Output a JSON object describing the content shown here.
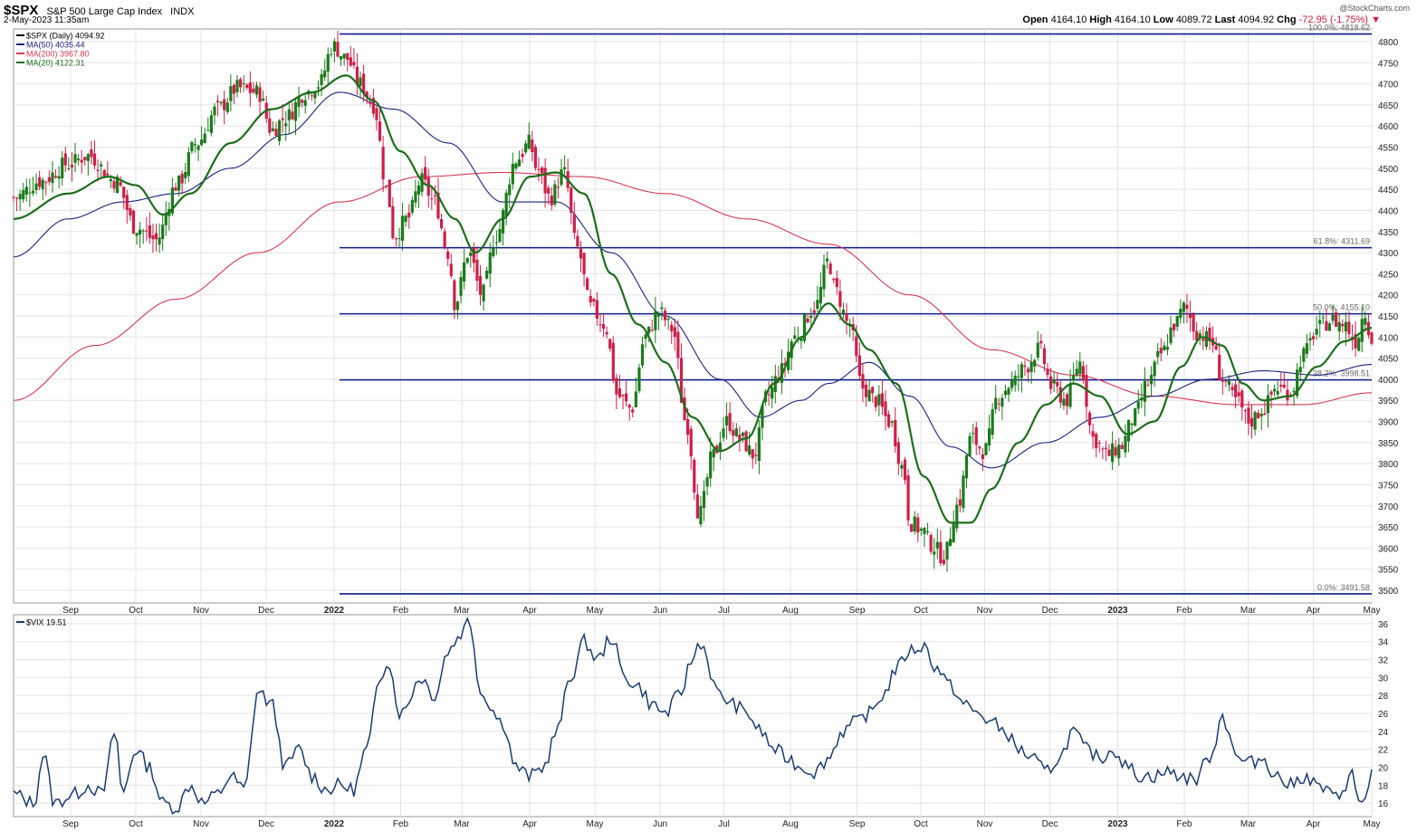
{
  "header": {
    "symbol": "$SPX",
    "description": "S&P 500 Large Cap Index",
    "exchange": "INDX",
    "datetime": "2-May-2023 11:35am",
    "brand": "@StockCharts.com",
    "open_label": "Open",
    "open": "4164.10",
    "high_label": "High",
    "high": "4164.10",
    "low_label": "Low",
    "low": "4089.72",
    "last_label": "Last",
    "last": "4094.92",
    "chg_label": "Chg",
    "chg": "-72.95 (-1.75%)"
  },
  "colors": {
    "price_up": "#1c7a1c",
    "price_down": "#cc1f4a",
    "ma50": "#1a237e",
    "ma200": "#d33a52",
    "ma20": "#1b6e1b",
    "fib": "#0d1a8c",
    "vix": "#1a3b6e",
    "grid": "#e3e3e3",
    "frame": "#9a9a9a"
  },
  "chart_data": [
    {
      "type": "candlestick",
      "title": "$SPX (Daily)",
      "legend": [
        {
          "name": "$SPX (Daily)",
          "value": "4094.92"
        },
        {
          "name": "MA(50)",
          "value": "4035.44"
        },
        {
          "name": "MA(200)",
          "value": "3967.80"
        },
        {
          "name": "MA(20)",
          "value": "4122.31"
        }
      ],
      "ylim": [
        3470,
        4830
      ],
      "yticks": [
        3500,
        3550,
        3600,
        3650,
        3700,
        3750,
        3800,
        3850,
        3900,
        3950,
        4000,
        4050,
        4100,
        4150,
        4200,
        4250,
        4300,
        4350,
        4400,
        4450,
        4500,
        4550,
        4600,
        4650,
        4700,
        4750,
        4800
      ],
      "x_labels": [
        {
          "label": "Sep",
          "t": 0.042
        },
        {
          "label": "Oct",
          "t": 0.09
        },
        {
          "label": "Nov",
          "t": 0.138
        },
        {
          "label": "Dec",
          "t": 0.186
        },
        {
          "label": "2022",
          "t": 0.236,
          "bold": true
        },
        {
          "label": "Feb",
          "t": 0.285
        },
        {
          "label": "Mar",
          "t": 0.33
        },
        {
          "label": "Apr",
          "t": 0.38
        },
        {
          "label": "May",
          "t": 0.428
        },
        {
          "label": "Jun",
          "t": 0.476
        },
        {
          "label": "Jul",
          "t": 0.523
        },
        {
          "label": "Aug",
          "t": 0.572
        },
        {
          "label": "Sep",
          "t": 0.621
        },
        {
          "label": "Oct",
          "t": 0.668
        },
        {
          "label": "Nov",
          "t": 0.715
        },
        {
          "label": "Dec",
          "t": 0.763
        },
        {
          "label": "2023",
          "t": 0.813,
          "bold": true
        },
        {
          "label": "Feb",
          "t": 0.862
        },
        {
          "label": "Mar",
          "t": 0.909
        },
        {
          "label": "Apr",
          "t": 0.957
        },
        {
          "label": "May",
          "t": 1.0
        }
      ],
      "fib_levels": [
        {
          "value": 4818,
          "label": "100.0%: 4818.62"
        },
        {
          "value": 4311.69,
          "label": "61.8%: 4311.69"
        },
        {
          "value": 4155.1,
          "label": "50.0%: 4155.10"
        },
        {
          "value": 3998.51,
          "label": "38.2%: 3998.51"
        },
        {
          "value": 3491.58,
          "label": "0.0%: 3491.58"
        }
      ],
      "close_anchors": [
        [
          0.0,
          4430
        ],
        [
          0.02,
          4470
        ],
        [
          0.04,
          4510
        ],
        [
          0.055,
          4530
        ],
        [
          0.075,
          4470
        ],
        [
          0.09,
          4360
        ],
        [
          0.105,
          4330
        ],
        [
          0.12,
          4460
        ],
        [
          0.135,
          4560
        ],
        [
          0.15,
          4640
        ],
        [
          0.165,
          4690
        ],
        [
          0.18,
          4680
        ],
        [
          0.19,
          4590
        ],
        [
          0.2,
          4620
        ],
        [
          0.215,
          4680
        ],
        [
          0.225,
          4700
        ],
        [
          0.235,
          4790
        ],
        [
          0.245,
          4760
        ],
        [
          0.255,
          4700
        ],
        [
          0.265,
          4650
        ],
        [
          0.275,
          4450
        ],
        [
          0.28,
          4340
        ],
        [
          0.29,
          4380
        ],
        [
          0.3,
          4470
        ],
        [
          0.31,
          4420
        ],
        [
          0.32,
          4300
        ],
        [
          0.325,
          4180
        ],
        [
          0.335,
          4300
        ],
        [
          0.345,
          4200
        ],
        [
          0.355,
          4340
        ],
        [
          0.37,
          4520
        ],
        [
          0.38,
          4560
        ],
        [
          0.385,
          4500
        ],
        [
          0.395,
          4430
        ],
        [
          0.405,
          4490
        ],
        [
          0.415,
          4310
        ],
        [
          0.425,
          4170
        ],
        [
          0.435,
          4130
        ],
        [
          0.445,
          3960
        ],
        [
          0.455,
          3930
        ],
        [
          0.465,
          4100
        ],
        [
          0.475,
          4160
        ],
        [
          0.485,
          4120
        ],
        [
          0.495,
          3900
        ],
        [
          0.505,
          3680
        ],
        [
          0.515,
          3820
        ],
        [
          0.525,
          3900
        ],
        [
          0.535,
          3860
        ],
        [
          0.545,
          3820
        ],
        [
          0.555,
          3960
        ],
        [
          0.565,
          4020
        ],
        [
          0.575,
          4100
        ],
        [
          0.59,
          4170
        ],
        [
          0.6,
          4280
        ],
        [
          0.605,
          4210
        ],
        [
          0.615,
          4130
        ],
        [
          0.625,
          3980
        ],
        [
          0.635,
          3950
        ],
        [
          0.645,
          3900
        ],
        [
          0.655,
          3790
        ],
        [
          0.66,
          3660
        ],
        [
          0.67,
          3640
        ],
        [
          0.675,
          3610
        ],
        [
          0.685,
          3580
        ],
        [
          0.695,
          3700
        ],
        [
          0.705,
          3860
        ],
        [
          0.715,
          3830
        ],
        [
          0.725,
          3960
        ],
        [
          0.735,
          3990
        ],
        [
          0.745,
          4030
        ],
        [
          0.755,
          4070
        ],
        [
          0.765,
          3980
        ],
        [
          0.775,
          3950
        ],
        [
          0.785,
          4040
        ],
        [
          0.795,
          3860
        ],
        [
          0.805,
          3820
        ],
        [
          0.815,
          3840
        ],
        [
          0.825,
          3910
        ],
        [
          0.835,
          3990
        ],
        [
          0.845,
          4060
        ],
        [
          0.855,
          4130
        ],
        [
          0.862,
          4170
        ],
        [
          0.872,
          4110
        ],
        [
          0.882,
          4090
        ],
        [
          0.89,
          4000
        ],
        [
          0.9,
          3950
        ],
        [
          0.91,
          3900
        ],
        [
          0.92,
          3930
        ],
        [
          0.93,
          3980
        ],
        [
          0.94,
          3970
        ],
        [
          0.95,
          4060
        ],
        [
          0.96,
          4120
        ],
        [
          0.97,
          4140
        ],
        [
          0.98,
          4130
        ],
        [
          0.988,
          4090
        ],
        [
          0.995,
          4160
        ],
        [
          1.0,
          4094
        ]
      ],
      "ma50_anchors": [
        [
          0.0,
          4290
        ],
        [
          0.04,
          4380
        ],
        [
          0.08,
          4420
        ],
        [
          0.12,
          4440
        ],
        [
          0.16,
          4500
        ],
        [
          0.2,
          4580
        ],
        [
          0.24,
          4680
        ],
        [
          0.28,
          4640
        ],
        [
          0.32,
          4560
        ],
        [
          0.36,
          4420
        ],
        [
          0.4,
          4420
        ],
        [
          0.44,
          4300
        ],
        [
          0.48,
          4150
        ],
        [
          0.52,
          4000
        ],
        [
          0.55,
          3910
        ],
        [
          0.58,
          3950
        ],
        [
          0.6,
          3990
        ],
        [
          0.63,
          4040
        ],
        [
          0.66,
          3960
        ],
        [
          0.69,
          3840
        ],
        [
          0.72,
          3790
        ],
        [
          0.76,
          3850
        ],
        [
          0.8,
          3910
        ],
        [
          0.84,
          3960
        ],
        [
          0.88,
          4000
        ],
        [
          0.92,
          4020
        ],
        [
          0.96,
          4010
        ],
        [
          1.0,
          4035
        ]
      ],
      "ma200_anchors": [
        [
          0.0,
          3950
        ],
        [
          0.06,
          4080
        ],
        [
          0.12,
          4190
        ],
        [
          0.18,
          4300
        ],
        [
          0.24,
          4420
        ],
        [
          0.3,
          4480
        ],
        [
          0.36,
          4490
        ],
        [
          0.42,
          4480
        ],
        [
          0.48,
          4440
        ],
        [
          0.54,
          4380
        ],
        [
          0.6,
          4320
        ],
        [
          0.66,
          4200
        ],
        [
          0.72,
          4070
        ],
        [
          0.78,
          4010
        ],
        [
          0.84,
          3960
        ],
        [
          0.9,
          3940
        ],
        [
          0.95,
          3940
        ],
        [
          1.0,
          3968
        ]
      ],
      "ma20_anchors": [
        [
          0.0,
          4380
        ],
        [
          0.04,
          4440
        ],
        [
          0.07,
          4480
        ],
        [
          0.09,
          4460
        ],
        [
          0.11,
          4390
        ],
        [
          0.13,
          4440
        ],
        [
          0.16,
          4560
        ],
        [
          0.19,
          4640
        ],
        [
          0.22,
          4680
        ],
        [
          0.245,
          4720
        ],
        [
          0.265,
          4660
        ],
        [
          0.285,
          4540
        ],
        [
          0.305,
          4460
        ],
        [
          0.325,
          4380
        ],
        [
          0.34,
          4300
        ],
        [
          0.36,
          4380
        ],
        [
          0.38,
          4480
        ],
        [
          0.4,
          4490
        ],
        [
          0.42,
          4440
        ],
        [
          0.44,
          4250
        ],
        [
          0.46,
          4130
        ],
        [
          0.48,
          4040
        ],
        [
          0.5,
          3910
        ],
        [
          0.52,
          3830
        ],
        [
          0.54,
          3860
        ],
        [
          0.56,
          3990
        ],
        [
          0.58,
          4100
        ],
        [
          0.6,
          4180
        ],
        [
          0.615,
          4130
        ],
        [
          0.63,
          4070
        ],
        [
          0.65,
          3990
        ],
        [
          0.67,
          3770
        ],
        [
          0.69,
          3660
        ],
        [
          0.705,
          3660
        ],
        [
          0.72,
          3740
        ],
        [
          0.74,
          3850
        ],
        [
          0.76,
          3940
        ],
        [
          0.78,
          3990
        ],
        [
          0.8,
          3960
        ],
        [
          0.82,
          3870
        ],
        [
          0.84,
          3900
        ],
        [
          0.86,
          4030
        ],
        [
          0.875,
          4100
        ],
        [
          0.89,
          4080
        ],
        [
          0.905,
          3990
        ],
        [
          0.92,
          3950
        ],
        [
          0.94,
          3960
        ],
        [
          0.96,
          4030
        ],
        [
          0.98,
          4090
        ],
        [
          1.0,
          4122
        ]
      ]
    },
    {
      "type": "line",
      "title": "$VIX",
      "legend": [
        {
          "name": "$VIX",
          "value": "19.51"
        }
      ],
      "ylim": [
        14.5,
        37
      ],
      "yticks": [
        16,
        18,
        20,
        22,
        24,
        26,
        28,
        30,
        32,
        34,
        36
      ],
      "series_anchors": [
        [
          0.0,
          17
        ],
        [
          0.015,
          16
        ],
        [
          0.022,
          21.5
        ],
        [
          0.03,
          16
        ],
        [
          0.045,
          17
        ],
        [
          0.055,
          18
        ],
        [
          0.065,
          17
        ],
        [
          0.075,
          24
        ],
        [
          0.08,
          17
        ],
        [
          0.09,
          22
        ],
        [
          0.1,
          20
        ],
        [
          0.11,
          16
        ],
        [
          0.12,
          15.5
        ],
        [
          0.13,
          18
        ],
        [
          0.14,
          16
        ],
        [
          0.15,
          17
        ],
        [
          0.16,
          19
        ],
        [
          0.17,
          17.5
        ],
        [
          0.18,
          28.5
        ],
        [
          0.19,
          27
        ],
        [
          0.2,
          20
        ],
        [
          0.21,
          22
        ],
        [
          0.22,
          19
        ],
        [
          0.23,
          17.5
        ],
        [
          0.24,
          18
        ],
        [
          0.25,
          17.5
        ],
        [
          0.26,
          22
        ],
        [
          0.27,
          30
        ],
        [
          0.275,
          32
        ],
        [
          0.285,
          26
        ],
        [
          0.3,
          30
        ],
        [
          0.31,
          28
        ],
        [
          0.32,
          33
        ],
        [
          0.33,
          35
        ],
        [
          0.335,
          36.5
        ],
        [
          0.345,
          28
        ],
        [
          0.36,
          25
        ],
        [
          0.37,
          20
        ],
        [
          0.38,
          19
        ],
        [
          0.39,
          20
        ],
        [
          0.4,
          24
        ],
        [
          0.41,
          30
        ],
        [
          0.42,
          34
        ],
        [
          0.43,
          32
        ],
        [
          0.44,
          34.5
        ],
        [
          0.45,
          30
        ],
        [
          0.46,
          29
        ],
        [
          0.47,
          27
        ],
        [
          0.48,
          26
        ],
        [
          0.49,
          28
        ],
        [
          0.5,
          32
        ],
        [
          0.505,
          34
        ],
        [
          0.52,
          28
        ],
        [
          0.53,
          27
        ],
        [
          0.54,
          26
        ],
        [
          0.55,
          24
        ],
        [
          0.56,
          22
        ],
        [
          0.57,
          21
        ],
        [
          0.58,
          20
        ],
        [
          0.59,
          19.5
        ],
        [
          0.6,
          21
        ],
        [
          0.61,
          24
        ],
        [
          0.62,
          25
        ],
        [
          0.63,
          26
        ],
        [
          0.64,
          28
        ],
        [
          0.65,
          31
        ],
        [
          0.66,
          33
        ],
        [
          0.67,
          33.5
        ],
        [
          0.68,
          31
        ],
        [
          0.69,
          29
        ],
        [
          0.7,
          27
        ],
        [
          0.71,
          26
        ],
        [
          0.72,
          25
        ],
        [
          0.73,
          24
        ],
        [
          0.74,
          22
        ],
        [
          0.75,
          21
        ],
        [
          0.76,
          19.5
        ],
        [
          0.77,
          21
        ],
        [
          0.78,
          24
        ],
        [
          0.79,
          22
        ],
        [
          0.8,
          21
        ],
        [
          0.81,
          22
        ],
        [
          0.82,
          20
        ],
        [
          0.83,
          19
        ],
        [
          0.84,
          19
        ],
        [
          0.85,
          19.5
        ],
        [
          0.86,
          19
        ],
        [
          0.87,
          18.5
        ],
        [
          0.875,
          20
        ],
        [
          0.88,
          21
        ],
        [
          0.885,
          23
        ],
        [
          0.89,
          26
        ],
        [
          0.895,
          24
        ],
        [
          0.9,
          21
        ],
        [
          0.91,
          20.5
        ],
        [
          0.92,
          21
        ],
        [
          0.93,
          19
        ],
        [
          0.94,
          18
        ],
        [
          0.95,
          19
        ],
        [
          0.96,
          18
        ],
        [
          0.97,
          17
        ],
        [
          0.975,
          16.5
        ],
        [
          0.98,
          18
        ],
        [
          0.985,
          19.5
        ],
        [
          0.99,
          16
        ],
        [
          0.995,
          16.5
        ],
        [
          1.0,
          19.5
        ]
      ]
    }
  ]
}
